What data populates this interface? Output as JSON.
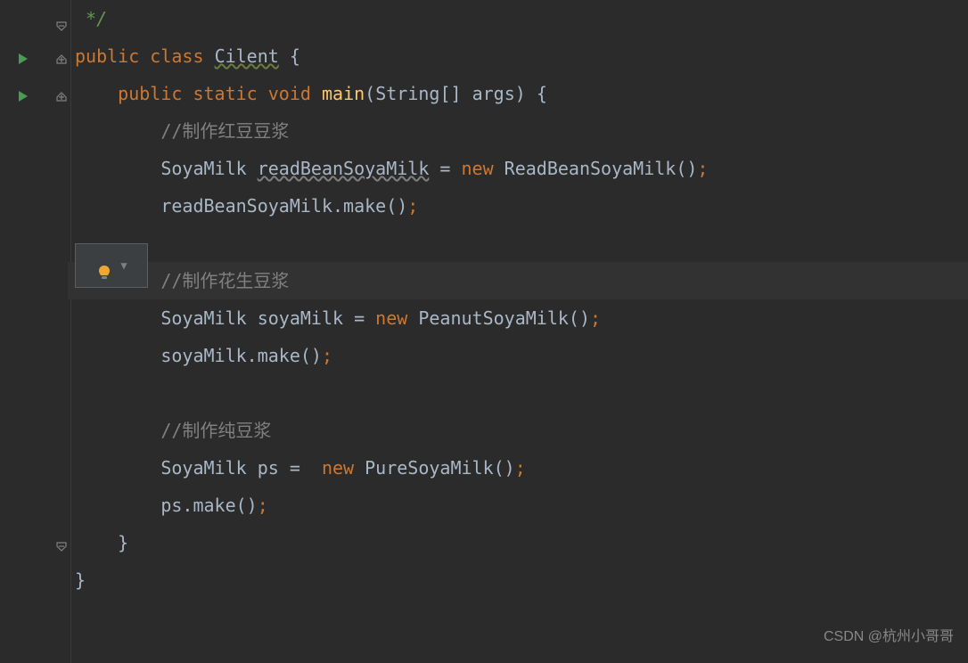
{
  "code": {
    "line1_comment_end": " */",
    "line2": {
      "public": "public",
      "class": "class",
      "name": "Cilent",
      "brace": "{"
    },
    "line3": {
      "public": "public",
      "static": "static",
      "void": "void",
      "main": "main",
      "args": "(String[] args)",
      "brace": "{"
    },
    "line4_comment": "//制作红豆豆浆",
    "line5": {
      "type": "SoyaMilk",
      "var": "readBeanSoyaMilk",
      "eq": " = ",
      "new": "new",
      "cls": "ReadBeanSoyaMilk()",
      "semi": ";"
    },
    "line6": {
      "var": "readBeanSoyaMilk",
      "call": ".make()",
      "semi": ";"
    },
    "line8_comment": "//制作花生豆浆",
    "line9": {
      "type": "SoyaMilk",
      "var": "soyaMilk",
      "eq": " = ",
      "new": "new",
      "cls": "PeanutSoyaMilk()",
      "semi": ";"
    },
    "line10": {
      "var": "soyaMilk",
      "call": ".make()",
      "semi": ";"
    },
    "line12_comment": "//制作纯豆浆",
    "line13": {
      "type": "SoyaMilk",
      "var": "ps",
      "eq": " =  ",
      "new": "new",
      "cls": "PureSoyaMilk()",
      "semi": ";"
    },
    "line14": {
      "var": "ps",
      "call": ".make()",
      "semi": ";"
    },
    "line15_brace": "}",
    "line16_brace": "}"
  },
  "watermark": "CSDN @杭州小哥哥"
}
